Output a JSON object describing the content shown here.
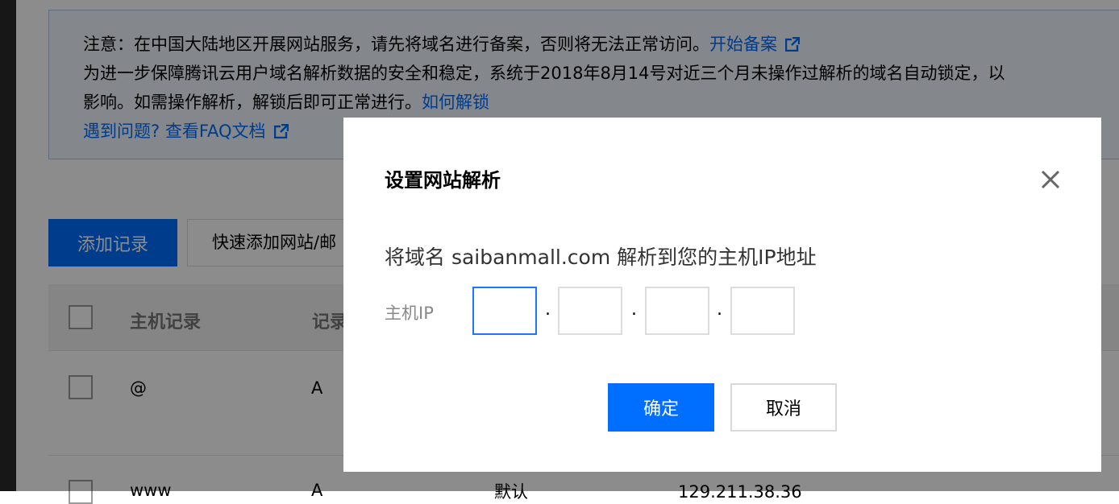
{
  "notice": {
    "line1_text": "注意：在中国大陆地区开展网站服务，请先将域名进行备案，否则将无法正常访问。",
    "line1_link": "开始备案",
    "line2_text": "为进一步保障腾讯云用户域名解析数据的安全和稳定，系统于2018年8月14号对近三个月未操作过解析的域名自动锁定，以",
    "line3_text": "影响。如需操作解析，解锁后即可正常进行。",
    "line3_link": "如何解锁",
    "line4_link": "遇到问题? 查看FAQ文档"
  },
  "toolbar": {
    "add_record_label": "添加记录",
    "quick_add_label": "快速添加网站/邮"
  },
  "table": {
    "headers": [
      "主机记录",
      "记录"
    ],
    "rows": [
      {
        "host": "@",
        "type": "A",
        "line": "",
        "value": ""
      },
      {
        "host": "www",
        "type": "A",
        "line": "默认",
        "value": "129.211.38.36"
      }
    ]
  },
  "dialog": {
    "title": "设置网站解析",
    "description": "将域名 saibanmall.com 解析到您的主机IP地址",
    "ip_label": "主机IP",
    "ip_values": [
      "",
      "",
      "",
      ""
    ],
    "ok_label": "确定",
    "cancel_label": "取消"
  },
  "colors": {
    "primary": "#006eff",
    "link": "#006eff",
    "notice_bg": "#f0f6fe",
    "notice_border": "#a9c8ef",
    "overlay": "rgba(0,0,0,0.45)"
  },
  "icons": [
    "external-link-icon",
    "close-icon"
  ]
}
